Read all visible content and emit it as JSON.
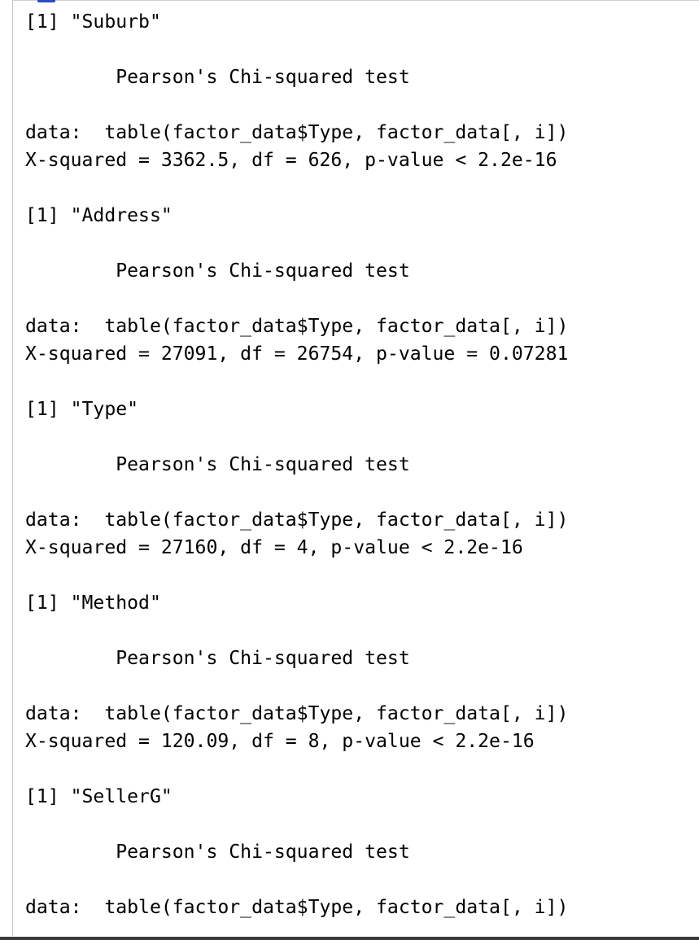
{
  "console": {
    "lines": [
      "[1] \"Suburb\"",
      "",
      "        Pearson's Chi-squared test",
      "",
      "data:  table(factor_data$Type, factor_data[, i])",
      "X-squared = 3362.5, df = 626, p-value < 2.2e-16",
      "",
      "[1] \"Address\"",
      "",
      "        Pearson's Chi-squared test",
      "",
      "data:  table(factor_data$Type, factor_data[, i])",
      "X-squared = 27091, df = 26754, p-value = 0.07281",
      "",
      "[1] \"Type\"",
      "",
      "        Pearson's Chi-squared test",
      "",
      "data:  table(factor_data$Type, factor_data[, i])",
      "X-squared = 27160, df = 4, p-value < 2.2e-16",
      "",
      "[1] \"Method\"",
      "",
      "        Pearson's Chi-squared test",
      "",
      "data:  table(factor_data$Type, factor_data[, i])",
      "X-squared = 120.09, df = 8, p-value < 2.2e-16",
      "",
      "[1] \"SellerG\"",
      "",
      "        Pearson's Chi-squared test",
      "",
      "data:  table(factor_data$Type, factor_data[, i])"
    ]
  },
  "colors": {
    "text": "#000000",
    "background": "#ffffff",
    "border": "#c8c8c8",
    "accent": "#2b4bc4"
  }
}
